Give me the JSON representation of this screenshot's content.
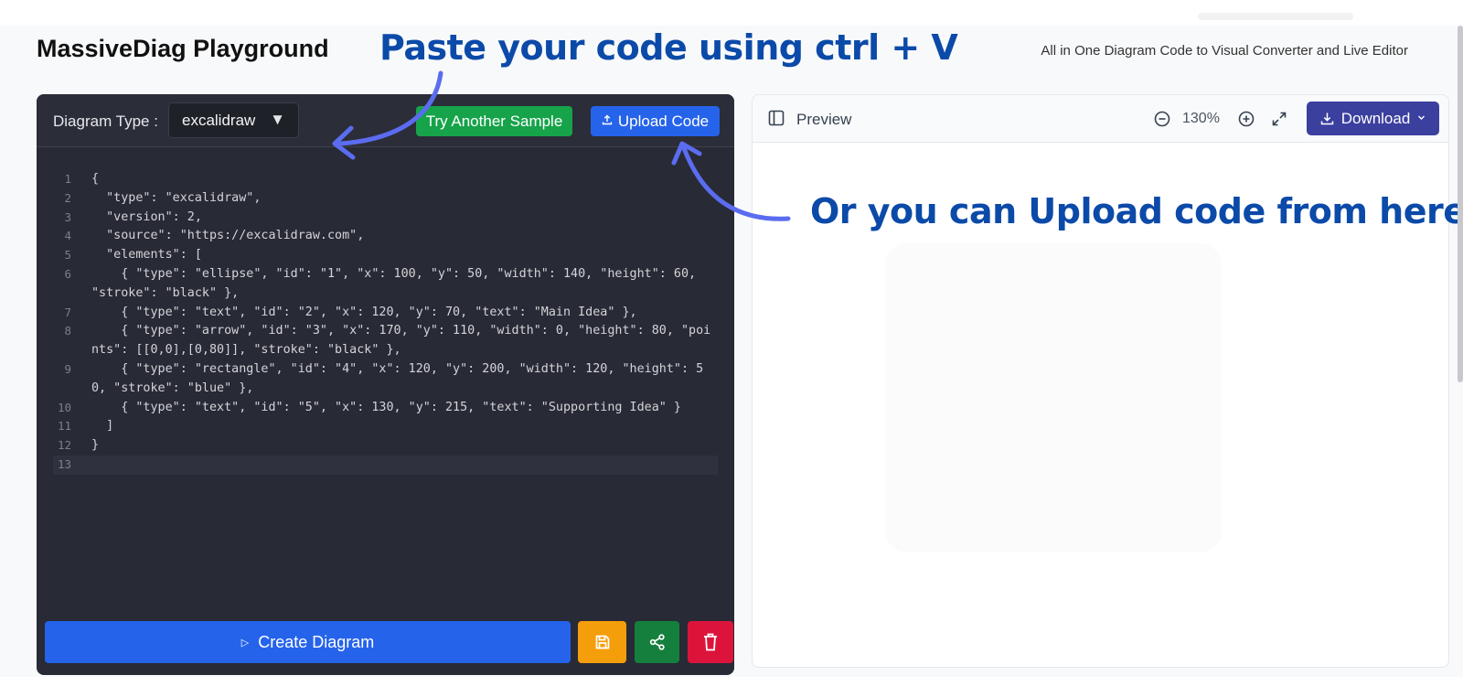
{
  "header": {
    "title": "MassiveDiag Playground",
    "tagline": "All in One Diagram Code to Visual Converter and Live Editor"
  },
  "annotations": {
    "paste": "Paste your code using  ctrl + V",
    "upload": "Or you can Upload code from here"
  },
  "editor": {
    "diagram_type_label": "Diagram Type :",
    "diagram_type_value": "excalidraw",
    "caret": "▼",
    "try_sample_label": "Try Another Sample",
    "upload_label": "Upload Code",
    "create_label": "Create Diagram",
    "lines": [
      {
        "n": "1",
        "text": "{"
      },
      {
        "n": "2",
        "text": "  \"type\": \"excalidraw\","
      },
      {
        "n": "3",
        "text": "  \"version\": 2,"
      },
      {
        "n": "4",
        "text": "  \"source\": \"https://excalidraw.com\","
      },
      {
        "n": "5",
        "text": "  \"elements\": ["
      },
      {
        "n": "6",
        "text": "    { \"type\": \"ellipse\", \"id\": \"1\", \"x\": 100, \"y\": 50, \"width\": 140, \"height\": 60, \"stroke\": \"black\" },"
      },
      {
        "n": "7",
        "text": "    { \"type\": \"text\", \"id\": \"2\", \"x\": 120, \"y\": 70, \"text\": \"Main Idea\" },"
      },
      {
        "n": "8",
        "text": "    { \"type\": \"arrow\", \"id\": \"3\", \"x\": 170, \"y\": 110, \"width\": 0, \"height\": 80, \"points\": [[0,0],[0,80]], \"stroke\": \"black\" },"
      },
      {
        "n": "9",
        "text": "    { \"type\": \"rectangle\", \"id\": \"4\", \"x\": 120, \"y\": 200, \"width\": 120, \"height\": 50, \"stroke\": \"blue\" },"
      },
      {
        "n": "10",
        "text": "    { \"type\": \"text\", \"id\": \"5\", \"x\": 130, \"y\": 215, \"text\": \"Supporting Idea\" }"
      },
      {
        "n": "11",
        "text": "  ]"
      },
      {
        "n": "12",
        "text": "}"
      },
      {
        "n": "13",
        "text": ""
      }
    ],
    "active_line": "13"
  },
  "preview": {
    "label": "Preview",
    "zoom_level": "130%",
    "download_label": "Download"
  },
  "colors": {
    "accent_blue": "#2563eb",
    "sample_green": "#16a34a",
    "save_amber": "#f59e0b",
    "share_green": "#15803d",
    "delete_red": "#dc143c",
    "download_indigo": "#3b3f9e",
    "annotation_blue": "#0b4aa8",
    "arrow_blue": "#5b6cf0"
  }
}
